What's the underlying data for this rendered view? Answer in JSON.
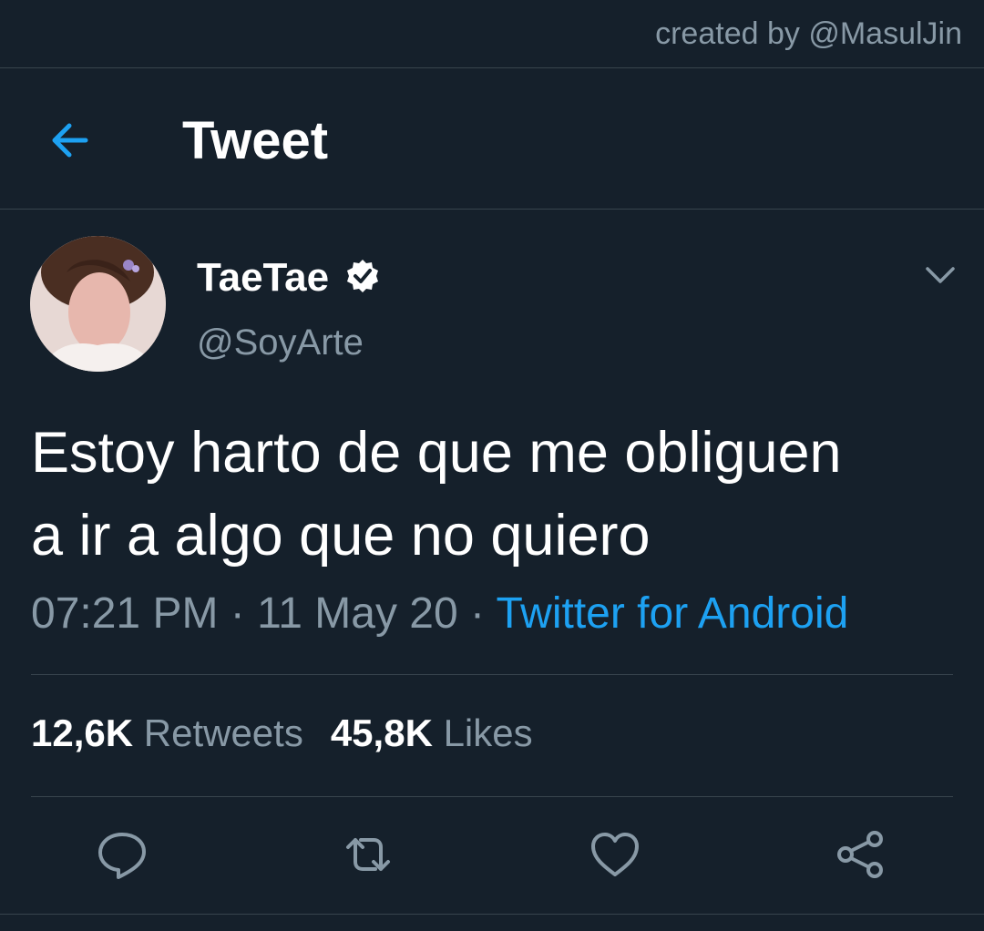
{
  "watermark": {
    "text": "created by @MasulJin"
  },
  "header": {
    "title": "Tweet",
    "back_icon": "arrow-left-icon"
  },
  "tweet": {
    "author_name": "TaeTae",
    "verified": true,
    "handle": "@SoyArte",
    "text_line1": "Estoy harto de que me obliguen",
    "text_line2": "a ir a algo que no quiero",
    "time": "07:21 PM",
    "separator": " · ",
    "date": "11 May 20",
    "source": "Twitter for Android"
  },
  "stats": {
    "retweets_count": "12,6K",
    "retweets_label": "Retweets",
    "likes_count": "45,8K",
    "likes_label": "Likes"
  },
  "actions": [
    "reply-icon",
    "retweet-icon",
    "like-icon",
    "share-icon"
  ],
  "colors": {
    "background": "#15202b",
    "divider": "#38444d",
    "secondary_text": "#8899a6",
    "accent": "#1da1f2",
    "text": "#ffffff"
  }
}
